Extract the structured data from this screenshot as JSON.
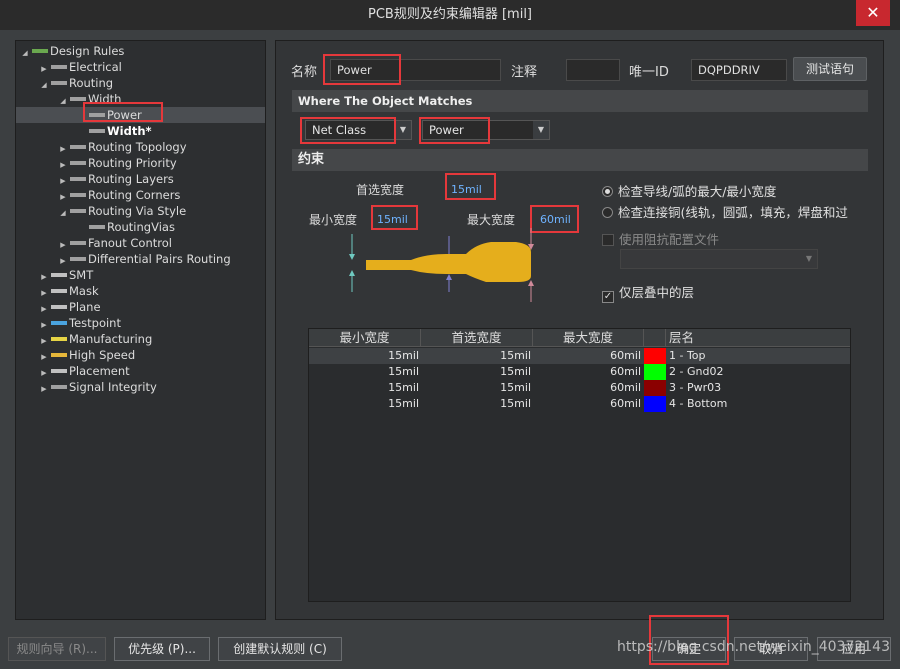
{
  "window": {
    "title": "PCB规则及约束编辑器 [mil]",
    "close_glyph": "✕"
  },
  "tree": [
    {
      "label": "Design Rules",
      "level": 0,
      "arrow": "◢",
      "icon": "rules-icon"
    },
    {
      "label": "Electrical",
      "level": 1,
      "arrow": "▶",
      "icon": "electrical-icon"
    },
    {
      "label": "Routing",
      "level": 1,
      "arrow": "◢",
      "icon": "routing-icon"
    },
    {
      "label": "Width",
      "level": 2,
      "arrow": "◢",
      "icon": "width-icon"
    },
    {
      "label": "Power",
      "level": 3,
      "arrow": "",
      "icon": "width-rule-icon",
      "selected": true
    },
    {
      "label": "Width*",
      "level": 3,
      "arrow": "",
      "icon": "width-rule-icon",
      "bold": true
    },
    {
      "label": "Routing Topology",
      "level": 2,
      "arrow": "▶",
      "icon": "topology-icon"
    },
    {
      "label": "Routing Priority",
      "level": 2,
      "arrow": "▶",
      "icon": "priority-icon"
    },
    {
      "label": "Routing Layers",
      "level": 2,
      "arrow": "▶",
      "icon": "layers-icon"
    },
    {
      "label": "Routing Corners",
      "level": 2,
      "arrow": "▶",
      "icon": "corners-icon"
    },
    {
      "label": "Routing Via Style",
      "level": 2,
      "arrow": "◢",
      "icon": "via-icon"
    },
    {
      "label": "RoutingVias",
      "level": 3,
      "arrow": "",
      "icon": "via-rule-icon"
    },
    {
      "label": "Fanout Control",
      "level": 2,
      "arrow": "▶",
      "icon": "fanout-icon"
    },
    {
      "label": "Differential Pairs Routing",
      "level": 2,
      "arrow": "▶",
      "icon": "diffpair-icon"
    },
    {
      "label": "SMT",
      "level": 1,
      "arrow": "▶",
      "icon": "smt-icon"
    },
    {
      "label": "Mask",
      "level": 1,
      "arrow": "▶",
      "icon": "mask-icon"
    },
    {
      "label": "Plane",
      "level": 1,
      "arrow": "▶",
      "icon": "plane-icon"
    },
    {
      "label": "Testpoint",
      "level": 1,
      "arrow": "▶",
      "icon": "testpoint-icon"
    },
    {
      "label": "Manufacturing",
      "level": 1,
      "arrow": "▶",
      "icon": "manufacturing-icon"
    },
    {
      "label": "High Speed",
      "level": 1,
      "arrow": "▶",
      "icon": "highspeed-icon"
    },
    {
      "label": "Placement",
      "level": 1,
      "arrow": "▶",
      "icon": "placement-icon"
    },
    {
      "label": "Signal Integrity",
      "level": 1,
      "arrow": "▶",
      "icon": "signal-icon"
    }
  ],
  "rule": {
    "name_label": "名称",
    "name_value": "Power",
    "comment_label": "注释",
    "comment_value": "",
    "uid_label": "唯一ID",
    "uid_value": "DQPDDRIV",
    "test_button": "测试语句"
  },
  "match": {
    "header": "Where The Object Matches",
    "type_value": "Net Class",
    "class_value": "Power"
  },
  "constraints": {
    "header": "约束",
    "preferred_label": "首选宽度",
    "preferred_value": "15mil",
    "min_label": "最小宽度",
    "min_value": "15mil",
    "max_label": "最大宽度",
    "max_value": "60mil",
    "radio_1": "检查导线/弧的最大/最小宽度",
    "radio_2": "检查连接铜(线轨，圆弧，填充，焊盘和过",
    "impedance_label": "使用阻抗配置文件",
    "stack_label": "仅层叠中的层",
    "check_glyph": "✓"
  },
  "table": {
    "headers": [
      "最小宽度",
      "首选宽度",
      "最大宽度",
      "层名"
    ],
    "rows": [
      {
        "min": "15mil",
        "pref": "15mil",
        "max": "60mil",
        "color": "#ff0000",
        "layer": "1 - Top"
      },
      {
        "min": "15mil",
        "pref": "15mil",
        "max": "60mil",
        "color": "#00ff00",
        "layer": "2 - Gnd02"
      },
      {
        "min": "15mil",
        "pref": "15mil",
        "max": "60mil",
        "color": "#8b0000",
        "layer": "3 - Pwr03"
      },
      {
        "min": "15mil",
        "pref": "15mil",
        "max": "60mil",
        "color": "#0000ff",
        "layer": "4 - Bottom"
      }
    ]
  },
  "footer": {
    "wizard": "规则向导 (R)...",
    "priority": "优先级 (P)...",
    "create_default": "创建默认规则 (C)",
    "ok": "确定",
    "cancel": "取消",
    "apply": "应用",
    "watermark": "https://blog.csdn.net/weixin_40372143"
  },
  "colors": {
    "accent_red": "#e5383b",
    "trace_gold": "#e5ae1c"
  }
}
